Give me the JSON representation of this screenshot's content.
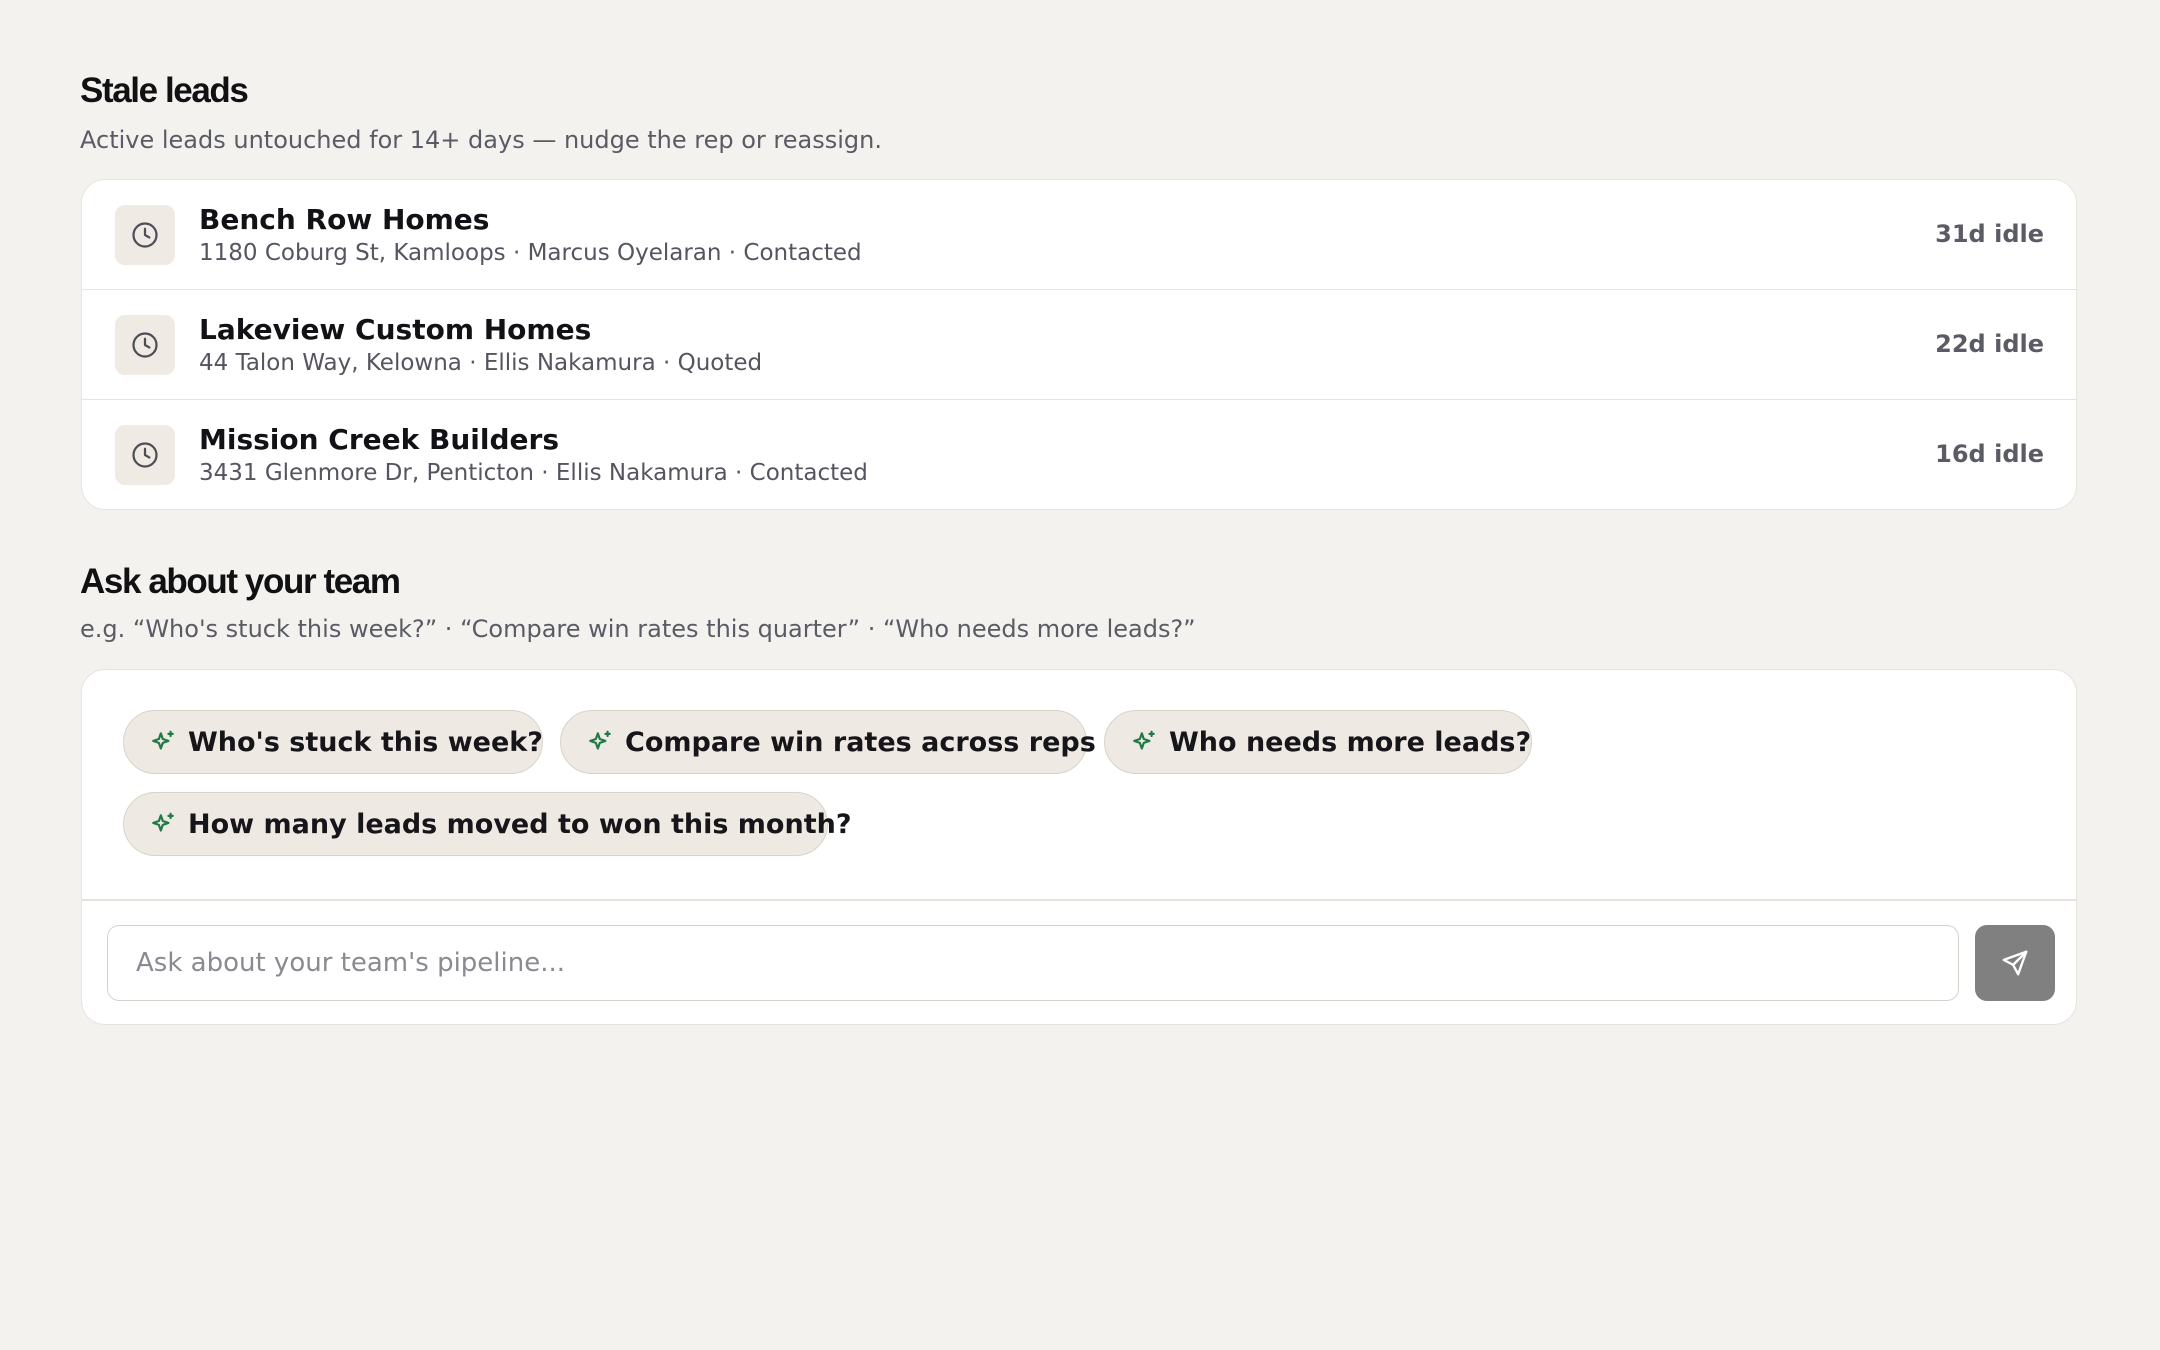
{
  "stale_leads": {
    "title": "Stale leads",
    "subtitle": "Active leads untouched for 14+ days — nudge the rep or reassign.",
    "items": [
      {
        "name": "Bench Row Homes",
        "meta": "1180 Coburg St, Kamloops · Marcus Oyelaran · Contacted",
        "idle": "31d idle",
        "icon": "clock-icon"
      },
      {
        "name": "Lakeview Custom Homes",
        "meta": "44 Talon Way, Kelowna · Ellis Nakamura · Quoted",
        "idle": "22d idle",
        "icon": "clock-icon"
      },
      {
        "name": "Mission Creek Builders",
        "meta": "3431 Glenmore Dr, Penticton · Ellis Nakamura · Contacted",
        "idle": "16d idle",
        "icon": "clock-icon"
      }
    ]
  },
  "ask": {
    "title": "Ask about your team",
    "subtitle": "e.g. “Who's stuck this week?” · “Compare win rates this quarter” · “Who needs more leads?”",
    "suggestions": [
      "Who's stuck this week?",
      "Compare win rates across reps",
      "Who needs more leads?",
      "How many leads moved to won this month?"
    ],
    "input_placeholder": "Ask about your team's pipeline...",
    "input_value": "",
    "send_icon": "send-icon",
    "suggestion_icon": "sparkle-icon"
  },
  "colors": {
    "background": "#f4f2ee",
    "card": "#ffffff",
    "icon_box": "#efebe4",
    "chip": "#eeeae3",
    "sparkle": "#1f7a45",
    "send_button": "#808080"
  }
}
